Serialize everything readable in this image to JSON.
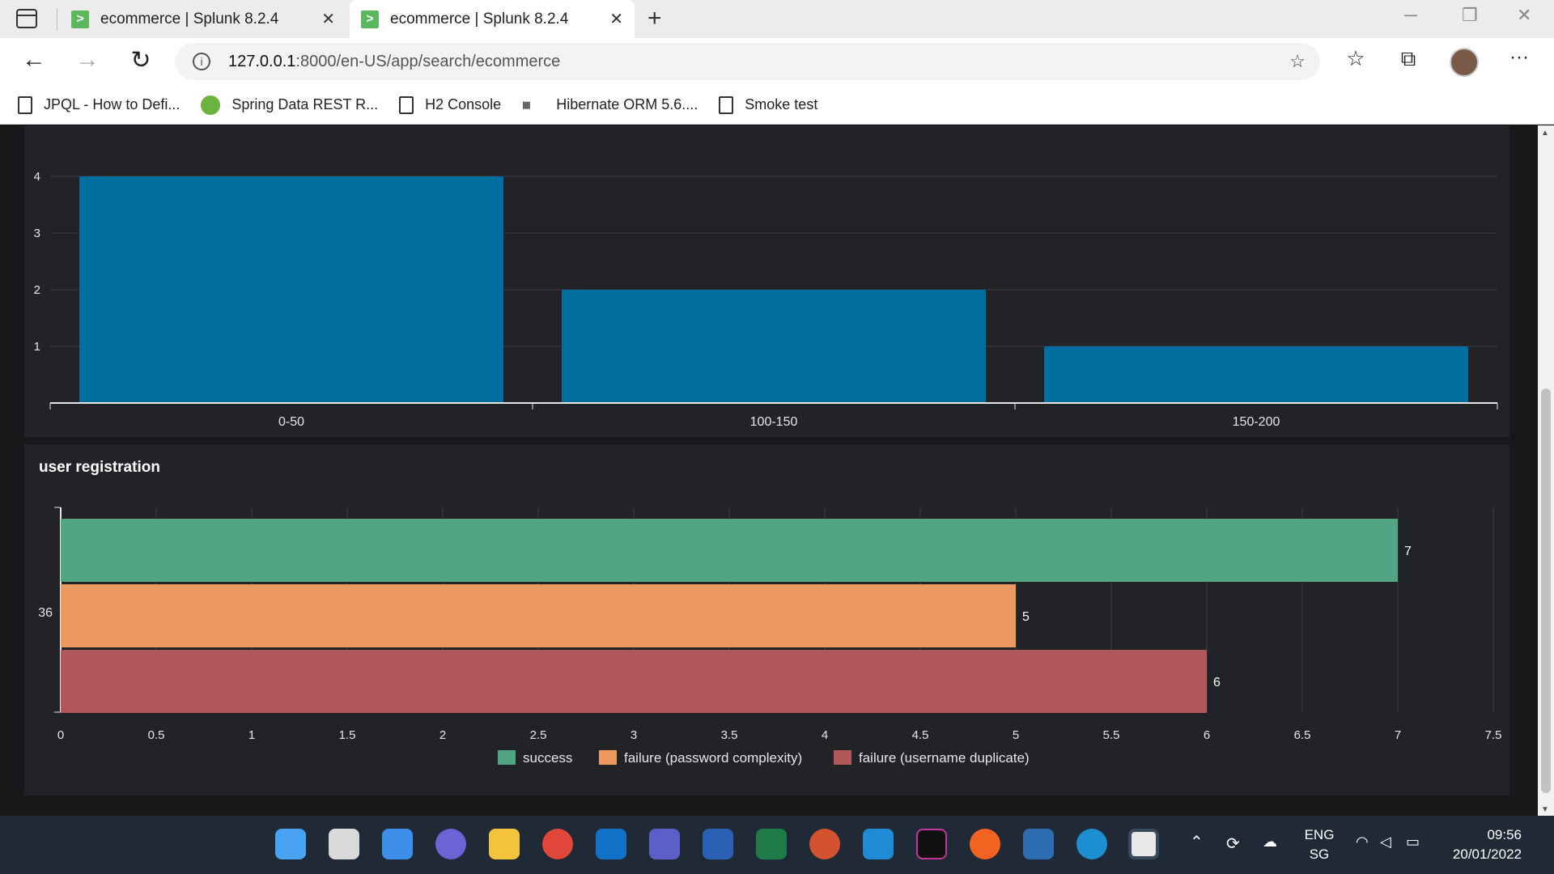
{
  "browser": {
    "tabs": [
      {
        "title": "ecommerce | Splunk 8.2.4"
      },
      {
        "title": "ecommerce | Splunk 8.2.4"
      }
    ],
    "url_host": "127.0.0.1",
    "url_path": ":8000/en-US/app/search/ecommerce",
    "bookmarks": [
      {
        "label": "JPQL - How to Defi..."
      },
      {
        "label": "Spring Data REST R..."
      },
      {
        "label": "H2 Console"
      },
      {
        "label": "Hibernate ORM 5.6...."
      },
      {
        "label": "Smoke test"
      }
    ]
  },
  "chart_data": [
    {
      "type": "bar",
      "title": "",
      "categories": [
        "0-50",
        "100-150",
        "150-200"
      ],
      "values": [
        4,
        2,
        1
      ],
      "ylim": [
        0,
        4
      ],
      "yticks": [
        "1",
        "2",
        "3",
        "4"
      ],
      "color": "#006e9f",
      "grid": true
    },
    {
      "type": "bar",
      "orientation": "horizontal",
      "title": "user registration",
      "categories": [
        "36"
      ],
      "series": [
        {
          "name": "success",
          "values": [
            7
          ],
          "color": "#52a584"
        },
        {
          "name": "failure (password complexity)",
          "values": [
            5
          ],
          "color": "#ec9960"
        },
        {
          "name": "failure (username duplicate)",
          "values": [
            6
          ],
          "color": "#b05759"
        }
      ],
      "data_labels": [
        "7",
        "5",
        "6"
      ],
      "xlim": [
        0,
        7.5
      ],
      "xticks": [
        "0",
        "0.5",
        "1",
        "1.5",
        "2",
        "2.5",
        "3",
        "3.5",
        "4",
        "4.5",
        "5",
        "5.5",
        "6",
        "6.5",
        "7",
        "7.5"
      ],
      "legend": "bottom",
      "grid": true
    }
  ],
  "tray": {
    "lang": "ENG",
    "region": "SG",
    "time": "09:56",
    "date": "20/01/2022"
  }
}
